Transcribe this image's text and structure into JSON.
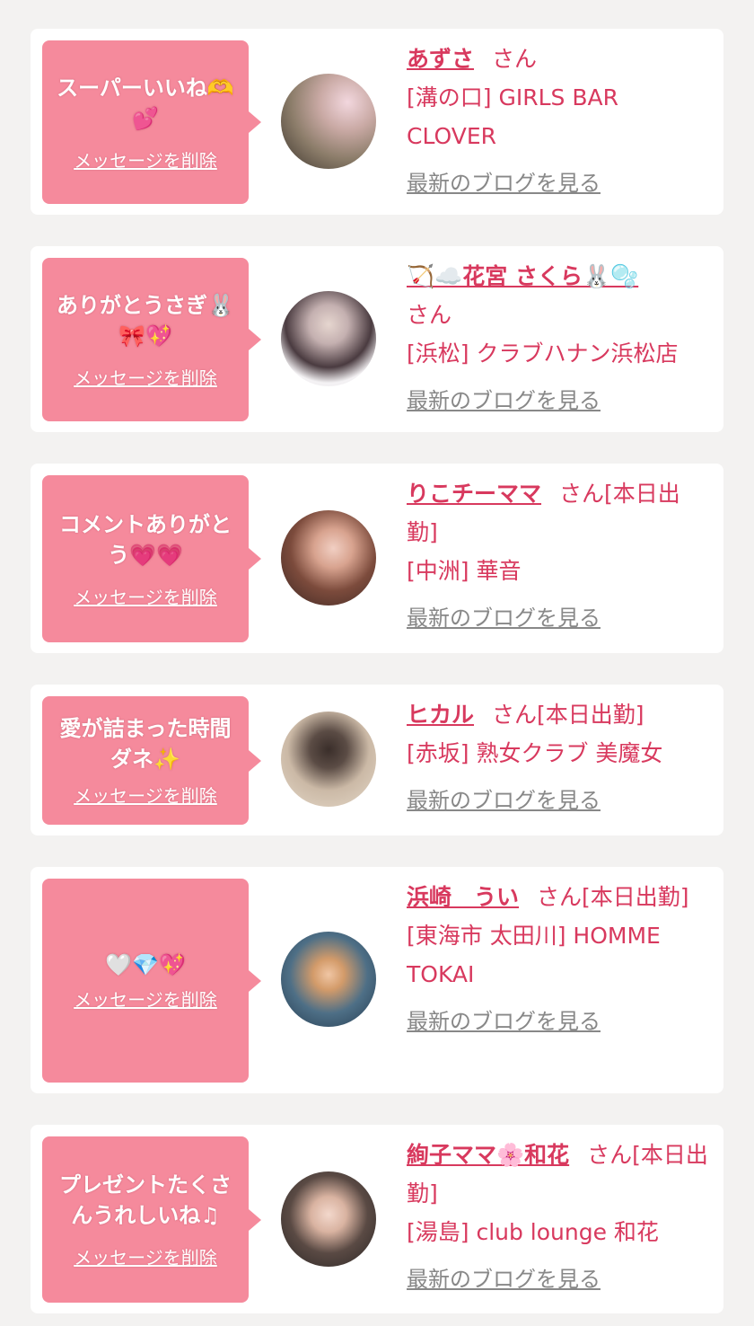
{
  "cards": [
    {
      "message": "スーパーいいね🫶💕",
      "delete_label": "メッセージを削除",
      "name": "あずさ",
      "suffix": "さん",
      "shop": "[溝の口] GIRLS BAR CLOVER",
      "blog_label": "最新のブログを見る"
    },
    {
      "message": "ありがとうさぎ🐰🎀💖",
      "delete_label": "メッセージを削除",
      "name": "🏹☁️花宮 さくら🐰🫧",
      "suffix": "さん",
      "shop": "[浜松] クラブハナン浜松店",
      "blog_label": "最新のブログを見る"
    },
    {
      "message": "コメントありがとう💗💗",
      "delete_label": "メッセージを削除",
      "name": "りこチーママ",
      "suffix": "さん[本日出勤]",
      "shop": "[中洲] 華音",
      "blog_label": "最新のブログを見る"
    },
    {
      "message": "愛が詰まった時間ダネ✨",
      "delete_label": "メッセージを削除",
      "name": "ヒカル",
      "suffix": "さん[本日出勤]",
      "shop": "[赤坂] 熟女クラブ 美魔女",
      "blog_label": "最新のブログを見る"
    },
    {
      "message": "🤍💎💖",
      "delete_label": "メッセージを削除",
      "name": "浜崎　うい",
      "suffix": "さん[本日出勤]",
      "shop": "[東海市 太田川] HOMME TOKAI",
      "blog_label": "最新のブログを見る"
    },
    {
      "message": "プレゼントたくさんうれしいね♫",
      "delete_label": "メッセージを削除",
      "name": "絢子ママ🌸和花",
      "suffix": "さん[本日出勤]",
      "shop": "[湯島] club lounge 和花",
      "blog_label": "最新のブログを見る"
    }
  ],
  "colors": {
    "bubble": "#f58a9c",
    "accent_text": "#d8395e",
    "muted_link": "#888888",
    "page_bg": "#f3f2f1"
  }
}
